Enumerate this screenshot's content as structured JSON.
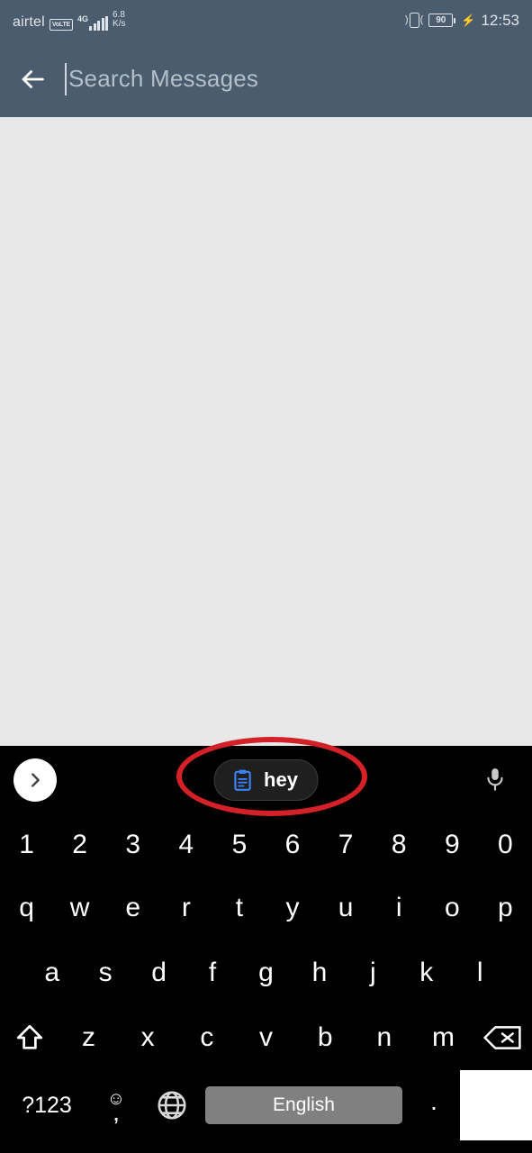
{
  "status_bar": {
    "carrier": "airtel",
    "volte_badge": "VoLTE",
    "network_generation": "4G",
    "signal_icon": "signal-bars-icon",
    "data_speed": "6.8",
    "data_speed_unit": "K/s",
    "vibrate_icon": "vibrate-icon",
    "battery_level": "90",
    "charging_icon": "charging-bolt-icon",
    "time": "12:53"
  },
  "app_bar": {
    "back_icon": "back-arrow-icon",
    "search_value": "",
    "search_placeholder": "Search Messages"
  },
  "keyboard": {
    "suggestion_bar": {
      "expand_icon": "chevron-right-icon",
      "clipboard_icon": "clipboard-icon",
      "clipboard_suggestion": "hey",
      "mic_icon": "microphone-icon"
    },
    "rows": {
      "numbers": [
        "1",
        "2",
        "3",
        "4",
        "5",
        "6",
        "7",
        "8",
        "9",
        "0"
      ],
      "top": [
        "q",
        "w",
        "e",
        "r",
        "t",
        "y",
        "u",
        "i",
        "o",
        "p"
      ],
      "home": [
        "a",
        "s",
        "d",
        "f",
        "g",
        "h",
        "j",
        "k",
        "l"
      ],
      "bottom": [
        "z",
        "x",
        "c",
        "v",
        "b",
        "n",
        "m"
      ]
    },
    "shift_icon": "shift-icon",
    "backspace_icon": "backspace-icon",
    "symbols_key": "?123",
    "emoji_icon": "emoji-smiley-icon",
    "comma_key": ",",
    "globe_icon": "globe-language-icon",
    "space_key": "English",
    "period_key": ".",
    "enter_key": ""
  },
  "annotation": {
    "shape": "ellipse-highlight",
    "color": "#d42027",
    "target": "clipboard-suggestion-chip"
  },
  "colors": {
    "header": "#4a5c6e",
    "content_background": "#e8e8e8",
    "keyboard_background": "#000000",
    "spacebar": "#808080",
    "clipboard_icon_blue": "#3b82f6",
    "annotation_red": "#d42027"
  }
}
